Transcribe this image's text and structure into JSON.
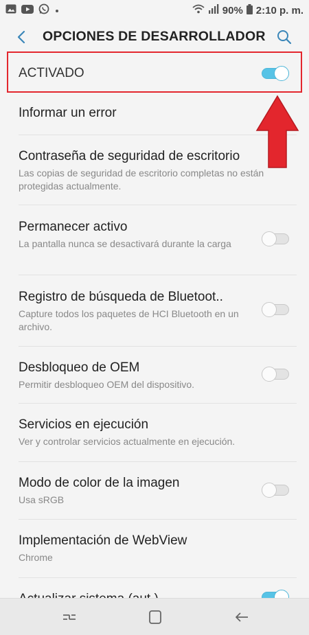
{
  "status_bar": {
    "battery_percent": "90%",
    "time": "2:10 p. m.",
    "left_icons": [
      "gallery-icon",
      "youtube-icon",
      "whatsapp-icon",
      "dot-icon"
    ],
    "right_icons": [
      "wifi-icon",
      "signal-icon",
      "battery-icon"
    ]
  },
  "app_bar": {
    "title": "OPCIONES DE DESARROLLADOR",
    "back_icon": "chevron-left-icon",
    "search_icon": "search-icon"
  },
  "master_switch": {
    "label": "ACTIVADO",
    "on": true
  },
  "items": [
    {
      "title": "Informar un error"
    },
    {
      "title": "Contraseña de seguridad de escritorio",
      "subtitle": "Las copias de seguridad de escritorio completas no están protegidas actualmente."
    },
    {
      "title": "Permanecer activo",
      "subtitle": "La pantalla nunca se desactivará durante la carga",
      "toggle": false
    },
    {
      "title": "Registro de búsqueda de Bluetoot..",
      "subtitle": "Capture todos los paquetes de HCI Bluetooth en un archivo.",
      "toggle": false
    },
    {
      "title": "Desbloqueo de OEM",
      "subtitle": "Permitir desbloqueo OEM del dispositivo.",
      "toggle": false
    },
    {
      "title": "Servicios en ejecución",
      "subtitle": "Ver y controlar servicios actualmente en ejecución."
    },
    {
      "title": "Modo de color de la imagen",
      "subtitle": "Usa sRGB",
      "toggle": false
    },
    {
      "title": "Implementación de WebView",
      "subtitle": "Chrome"
    },
    {
      "title": "Actualizar sistema (aut.)",
      "toggle": true
    }
  ],
  "colors": {
    "accent": "#57c3e6",
    "annotation_red": "#e3262d",
    "background": "#f4f4f4"
  },
  "nav_bar": {
    "icons": [
      "recent-apps-icon",
      "home-icon",
      "back-icon"
    ]
  }
}
